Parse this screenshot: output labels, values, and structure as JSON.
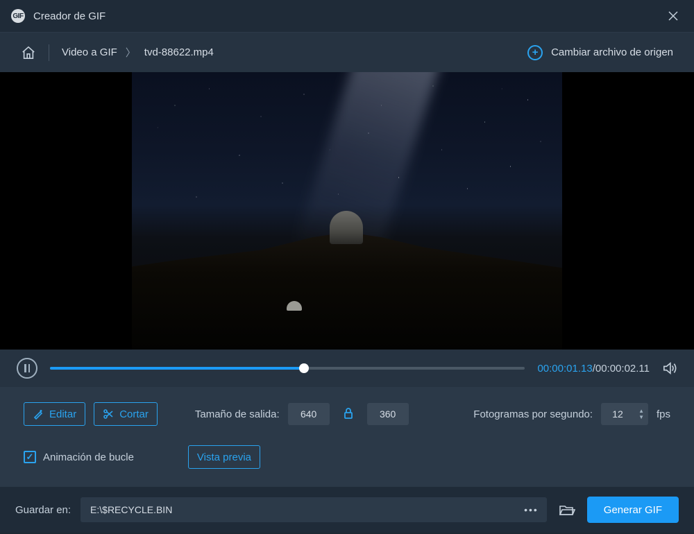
{
  "titlebar": {
    "app_name": "GIF",
    "title": "Creador de GIF"
  },
  "nav": {
    "crumb1": "Video a GIF",
    "crumb2": "tvd-88622.mp4",
    "change_source": "Cambiar archivo de origen"
  },
  "playback": {
    "current_time": "00:00:01.13",
    "total_time": "00:00:02.11",
    "progress_pct": 53.5
  },
  "options": {
    "edit_label": "Editar",
    "cut_label": "Cortar",
    "output_size_label": "Tamaño de salida:",
    "width_value": "640",
    "height_value": "360",
    "fps_label": "Fotogramas por segundo:",
    "fps_value": "12",
    "fps_unit": "fps",
    "loop_label": "Animación de bucle",
    "loop_checked": true,
    "preview_label": "Vista previa"
  },
  "footer": {
    "save_in_label": "Guardar en:",
    "path_value": "E:\\$RECYCLE.BIN",
    "generate_label": "Generar GIF"
  }
}
